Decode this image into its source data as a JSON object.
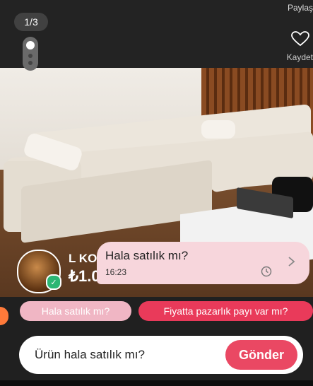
{
  "gallery": {
    "counter": "1/3"
  },
  "actions": {
    "share_label": "Paylaş",
    "save_label": "Kaydet"
  },
  "seller": {
    "name": "L KO",
    "price": "₺1.0"
  },
  "message": {
    "text": "Hala satılık mı?",
    "time": "16:23"
  },
  "quick_replies": [
    {
      "label": "Hala satılık mı?"
    },
    {
      "label": "Fiyatta pazarlık payı var mı?"
    }
  ],
  "composer": {
    "value": "Ürün hala satılık mı?",
    "send_label": "Gönder"
  },
  "colors": {
    "accent": "#e93a5a",
    "bubble": "#f7d6dc",
    "chip_light": "#f0b6c4"
  }
}
